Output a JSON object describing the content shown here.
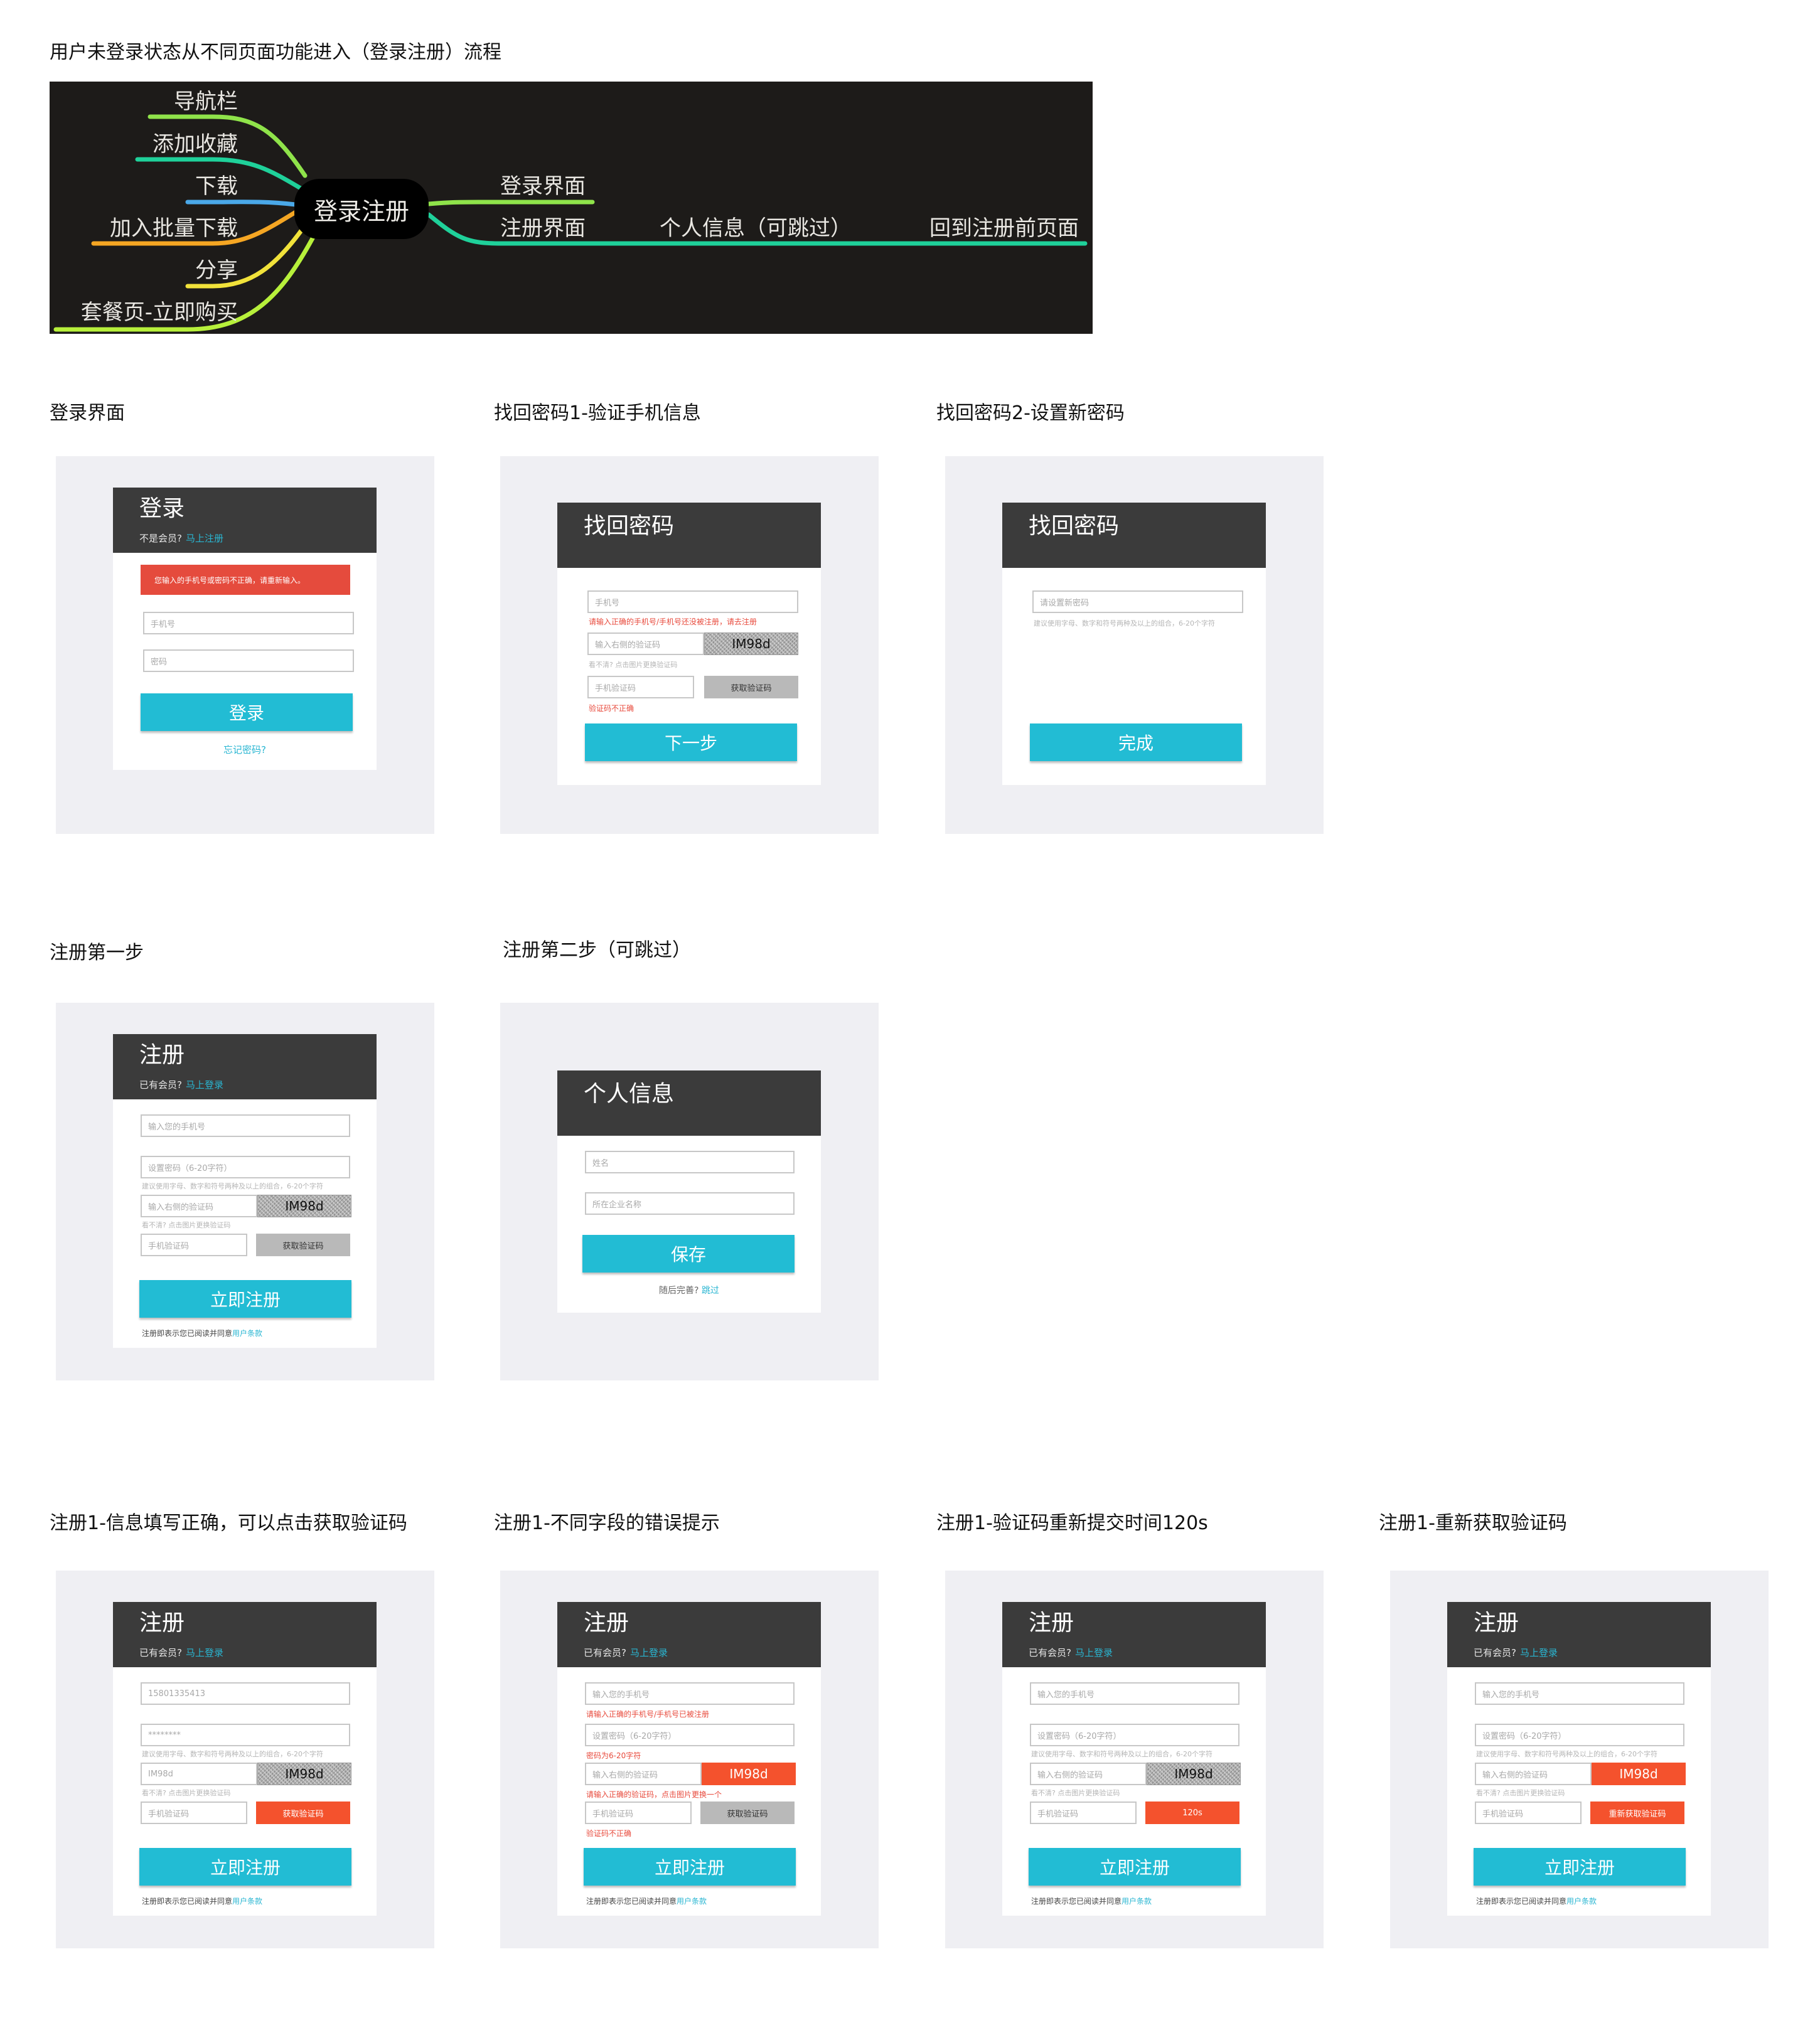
{
  "page_title": "用户未登录状态从不同页面功能进入（登录注册）流程",
  "mindmap": {
    "center": "登录注册",
    "left": [
      "导航栏",
      "添加收藏",
      "下载",
      "加入批量下载",
      "分享",
      "套餐页-立即购买"
    ],
    "right_top": "登录界面",
    "right_bottom": "注册界面",
    "mid": "个人信息（可跳过）",
    "end": "回到注册前页面",
    "colors": [
      "#8fe34a",
      "#1fd19a",
      "#4aa8e8",
      "#f5a623",
      "#f1e23a",
      "#b7f03b",
      "#1fd19a"
    ]
  },
  "headings": {
    "login": "登录界面",
    "find1": "找回密码1-验证手机信息",
    "find2": "找回密码2-设置新密码",
    "reg1": "注册第一步",
    "reg2": "注册第二步（可跳过）",
    "r1a": "注册1-信息填写正确，可以点击获取验证码",
    "r1b": "注册1-不同字段的错误提示",
    "r1c": "注册1-验证码重新提交时间120s",
    "r1d": "注册1-重新获取验证码"
  },
  "login": {
    "title": "登录",
    "sub": "不是会员?",
    "sub_link": "马上注册",
    "alert": "您输入的手机号或密码不正确，请重新输入。",
    "phone": "手机号",
    "password": "密码",
    "btn": "登录",
    "forgot": "忘记密码?"
  },
  "find1": {
    "title": "找回密码",
    "phone": "手机号",
    "phone_err": "请输入正确的手机号/手机号还没被注册，请去注册",
    "captcha_ph": "输入右侧的验证码",
    "captcha": "IM98d",
    "hint": "看不清? 点击图片更换验证码",
    "sms_ph": "手机验证码",
    "sms_btn": "获取验证码",
    "sms_err": "验证码不正确",
    "btn": "下一步"
  },
  "find2": {
    "title": "找回密码",
    "pwd_ph": "请设置新密码",
    "hint": "建议使用字母、数字和符号两种及以上的组合，6-20个字符",
    "btn": "完成"
  },
  "reg1": {
    "title": "注册",
    "sub": "已有会员?",
    "sub_link": "马上登录",
    "phone_ph": "输入您的手机号",
    "pwd_ph": "设置密码（6-20字符）",
    "pwd_hint": "建议使用字母、数字和符号两种及以上的组合，6-20个字符",
    "captcha_ph": "输入右侧的验证码",
    "captcha": "IM98d",
    "captcha_hint": "看不清? 点击图片更换验证码",
    "sms_ph": "手机验证码",
    "sms_btn": "获取验证码",
    "btn": "立即注册",
    "terms": "注册即表示您已阅读并同意",
    "terms_link": "用户条款"
  },
  "reg2": {
    "title": "个人信息",
    "name_ph": "姓名",
    "company_ph": "所在企业名称",
    "btn": "保存",
    "later": "随后完善?",
    "skip": "跳过"
  },
  "r1a": {
    "phone_val": "15801335413",
    "pwd_val": "********",
    "captcha_val": "IM98d"
  },
  "r1b": {
    "phone_err": "请输入正确的手机号/手机号已被注册",
    "pwd_err": "密码为6-20字符",
    "captcha_err": "请输入正确的验证码，点击图片更换一个",
    "sms_err": "验证码不正确"
  },
  "r1c": {
    "sms_btn": "120s"
  },
  "r1d": {
    "sms_btn": "重新获取验证码"
  }
}
